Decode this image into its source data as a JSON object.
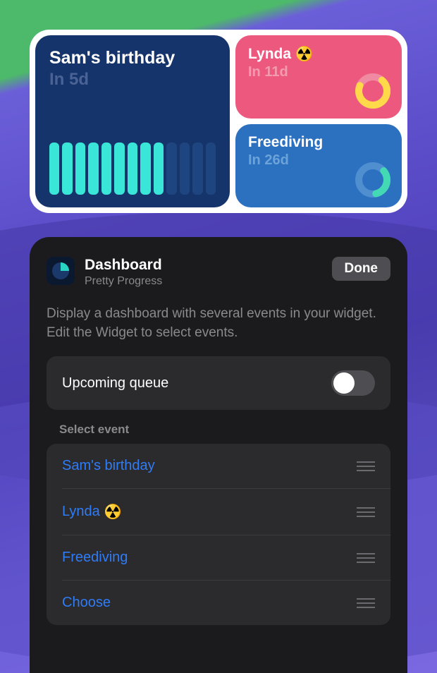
{
  "widget": {
    "left": {
      "title": "Sam's birthday",
      "subtitle": "In 5d",
      "bars_total": 13,
      "bars_filled": 9
    },
    "top_right": {
      "title": "Lynda",
      "emoji": "☢️",
      "subtitle": "In 11d"
    },
    "bottom_right": {
      "title": "Freediving",
      "subtitle": "In 26d"
    }
  },
  "settings": {
    "app_title": "Dashboard",
    "app_subtitle": "Pretty Progress",
    "done_label": "Done",
    "description": "Display a dashboard with several events in your widget. Edit the Widget to select events.",
    "toggle_label": "Upcoming queue",
    "toggle_on": false,
    "section_label": "Select event",
    "events": [
      {
        "label": "Sam's birthday",
        "emoji": ""
      },
      {
        "label": "Lynda",
        "emoji": "☢️"
      },
      {
        "label": "Freediving",
        "emoji": ""
      },
      {
        "label": "Choose",
        "emoji": ""
      }
    ]
  }
}
